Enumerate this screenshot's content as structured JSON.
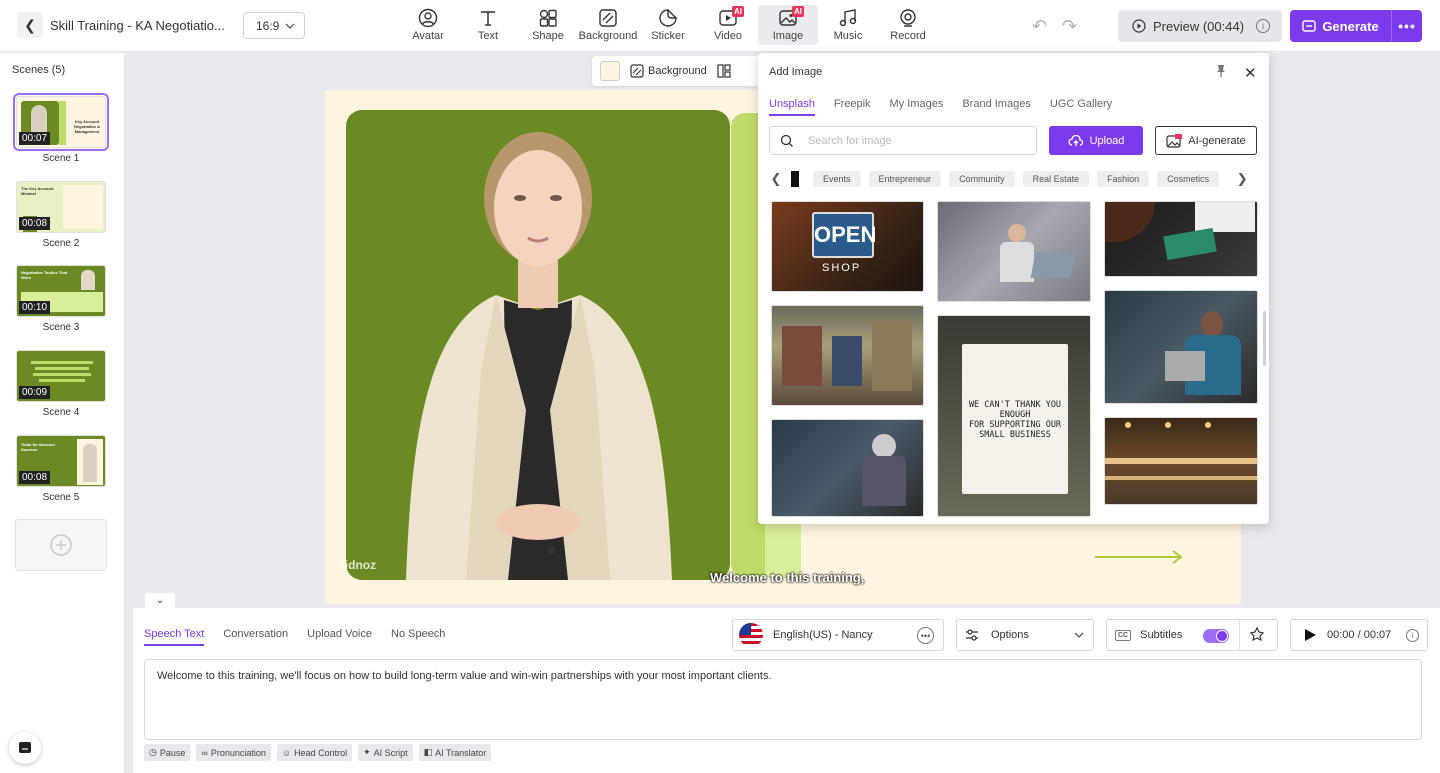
{
  "header": {
    "project_title": "Skill Training - KA Negotiatio...",
    "aspect_ratio": "16:9",
    "tools": [
      {
        "label": "Avatar",
        "icon": "avatar-icon"
      },
      {
        "label": "Text",
        "icon": "text-icon"
      },
      {
        "label": "Shape",
        "icon": "shape-icon"
      },
      {
        "label": "Background",
        "icon": "background-icon"
      },
      {
        "label": "Sticker",
        "icon": "sticker-icon"
      },
      {
        "label": "Video",
        "icon": "video-icon",
        "badge": "AI"
      },
      {
        "label": "Image",
        "icon": "image-icon",
        "badge": "AI",
        "active": true
      },
      {
        "label": "Music",
        "icon": "music-icon"
      },
      {
        "label": "Record",
        "icon": "record-icon"
      }
    ],
    "preview_label": "Preview (00:44)",
    "generate_label": "Generate",
    "accent_color": "#7c3aed"
  },
  "scenes": {
    "title": "Scenes (5)",
    "items": [
      {
        "name": "Scene 1",
        "duration": "00:07",
        "thumb_title": "Key Account Negotiation & Management"
      },
      {
        "name": "Scene 2",
        "duration": "00:08",
        "thumb_title": "The Key Account Mindset"
      },
      {
        "name": "Scene 3",
        "duration": "00:10",
        "thumb_title": "Negotiation Tactics That Work"
      },
      {
        "name": "Scene 4",
        "duration": "00:09"
      },
      {
        "name": "Scene 5",
        "duration": "00:08",
        "thumb_title": "Tools for Account Success"
      }
    ]
  },
  "canvas": {
    "background_label": "Background",
    "background_color": "#fdf5df",
    "subtitle": "Welcome to this training,",
    "watermark": "Vidnoz"
  },
  "add_image": {
    "title": "Add Image",
    "tabs": [
      "Unsplash",
      "Freepik",
      "My Images",
      "Brand Images",
      "UGC Gallery"
    ],
    "search_placeholder": "Search for image",
    "upload_label": "Upload",
    "ai_generate_label": "AI-generate",
    "categories": [
      "Events",
      "Entrepreneur",
      "Community",
      "Real Estate",
      "Fashion",
      "Cosmetics"
    ],
    "sign_open": "OPEN",
    "sign_shop": "SHOP",
    "sign_thanks": [
      "WE CAN'T THANK YOU",
      "ENOUGH",
      "FOR SUPPORTING OUR",
      "SMALL BUSINESS"
    ]
  },
  "speech": {
    "tabs": [
      "Speech Text",
      "Conversation",
      "Upload Voice",
      "No Speech"
    ],
    "voice": "English(US) - Nancy",
    "options_label": "Options",
    "subtitles_label": "Subtitles",
    "subtitles_on": true,
    "time": "00:00 / 00:07",
    "text": "Welcome to this training, we'll focus on how to build long-term value and win-win partnerships with your most important clients.",
    "chips": [
      "Pause",
      "Pronunciation",
      "Head Control",
      "AI Script",
      "AI Translator"
    ]
  }
}
